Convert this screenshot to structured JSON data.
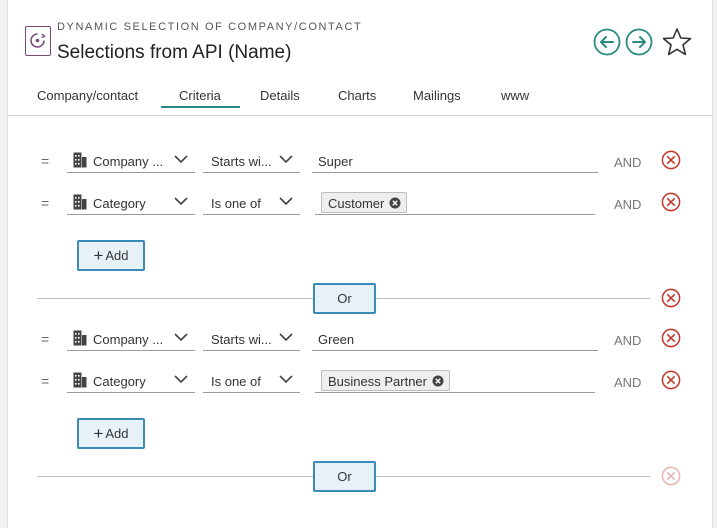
{
  "header": {
    "subtitle": "DYNAMIC SELECTION OF COMPANY/CONTACT",
    "title": "Selections from API (Name)"
  },
  "tabs": [
    "Company/contact",
    "Criteria",
    "Details",
    "Charts",
    "Mailings",
    "www"
  ],
  "active_tab": "Criteria",
  "groups": [
    {
      "rows": [
        {
          "eq": "=",
          "field": "Company ...",
          "operator": "Starts wi...",
          "value": "Super",
          "conj": "AND"
        },
        {
          "eq": "=",
          "field": "Category",
          "operator": "Is one of",
          "tag": "Customer",
          "conj": "AND"
        }
      ],
      "add_label": "Add",
      "or_label": "Or"
    },
    {
      "rows": [
        {
          "eq": "=",
          "field": "Company ...",
          "operator": "Starts wi...",
          "value": "Green",
          "conj": "AND"
        },
        {
          "eq": "=",
          "field": "Category",
          "operator": "Is one of",
          "tag": "Business Partner",
          "conj": "AND"
        }
      ],
      "add_label": "Add",
      "or_label": "Or"
    }
  ],
  "colors": {
    "accent": "#2a8b82",
    "button_border": "#3a8cb8",
    "remove_red": "#c0392b",
    "remove_disabled": "#e8b6b0"
  }
}
